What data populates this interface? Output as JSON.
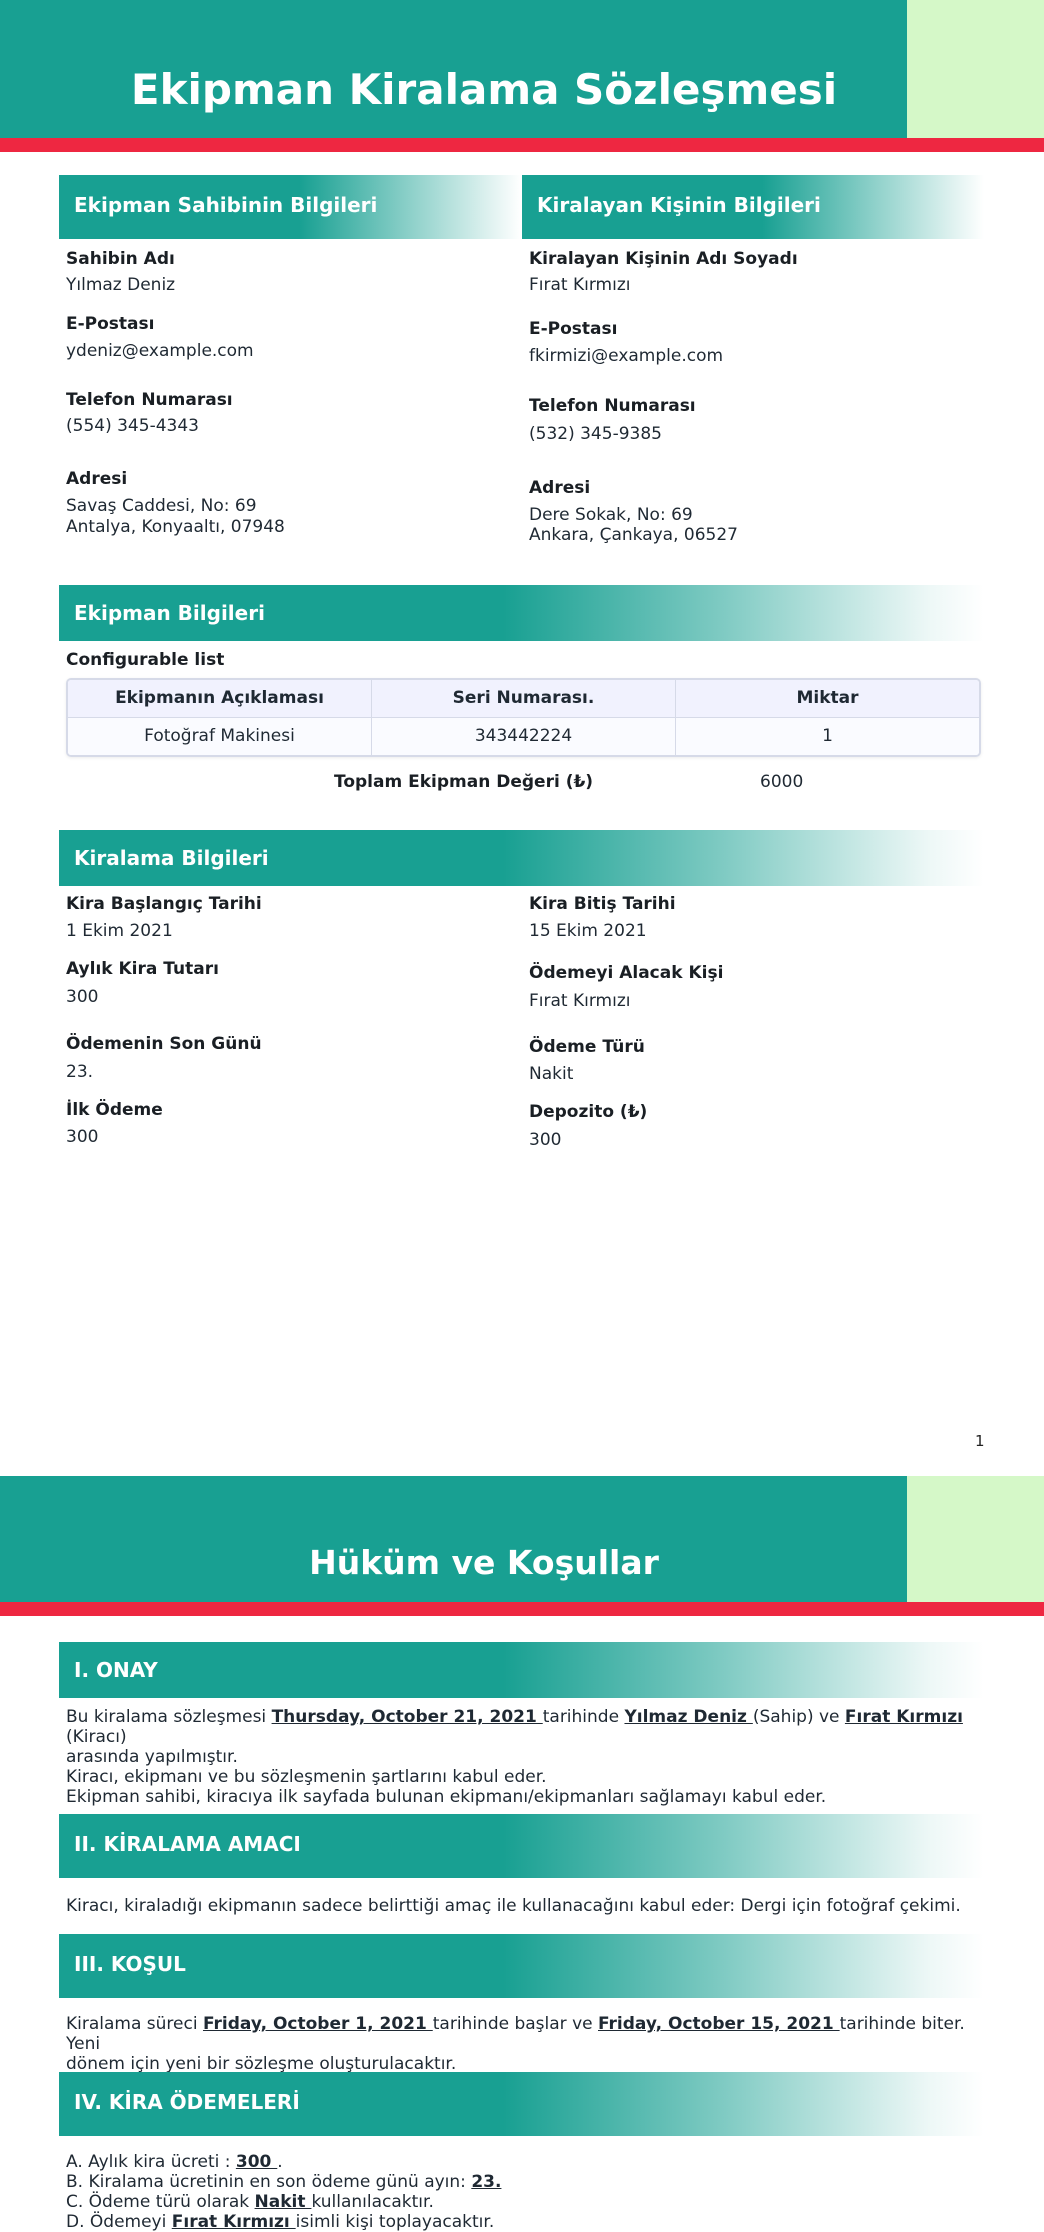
{
  "colors": {
    "teal": "#18a092",
    "mint": "#d5f8c8",
    "red": "#ee2741"
  },
  "page1": {
    "title": "Ekipman Kiralama Sözleşmesi",
    "owner": {
      "heading": "Ekipman Sahibinin Bilgileri",
      "name_label": "Sahibin Adı",
      "name": "Yılmaz Deniz",
      "email_label": "E-Postası",
      "email": "ydeniz@example.com",
      "phone_label": "Telefon Numarası",
      "phone": "(554) 345-4343",
      "address_label": "Adresi",
      "address_line1": "Savaş Caddesi, No: 69",
      "address_line2": "Antalya, Konyaaltı, 07948"
    },
    "renter": {
      "heading": "Kiralayan Kişinin Bilgileri",
      "name_label": "Kiralayan Kişinin Adı Soyadı",
      "name": "Fırat Kırmızı",
      "email_label": "E-Postası",
      "email": "fkirmizi@example.com",
      "phone_label": "Telefon Numarası",
      "phone": "(532) 345-9385",
      "address_label": "Adresi",
      "address_line1": "Dere Sokak, No: 69",
      "address_line2": "Ankara, Çankaya, 06527"
    },
    "equipment": {
      "heading": "Ekipman Bilgileri",
      "list_label": "Configurable list",
      "columns": [
        "Ekipmanın Açıklaması",
        "Seri Numarası.",
        "Miktar"
      ],
      "rows": [
        [
          "Fotoğraf Makinesi",
          "343442224",
          "1"
        ]
      ],
      "total_label": "Toplam Ekipman Değeri (₺)",
      "total_value": "6000"
    },
    "rental": {
      "heading": "Kiralama Bilgileri",
      "start_label": "Kira Başlangıç Tarihi",
      "start": "1 Ekim 2021",
      "end_label": "Kira Bitiş Tarihi",
      "end": "15 Ekim 2021",
      "monthly_label": "Aylık Kira Tutarı",
      "monthly": "300",
      "payee_label": "Ödemeyi Alacak Kişi",
      "payee": "Fırat Kırmızı",
      "due_label": "Ödemenin Son Günü",
      "due": "23.",
      "paytype_label": "Ödeme Türü",
      "paytype": "Nakit",
      "first_label": "İlk Ödeme",
      "first": "300",
      "deposit_label": "Depozito (₺)",
      "deposit": "300"
    },
    "page_number": "1"
  },
  "page2": {
    "title": "Hüküm ve Koşullar",
    "s1": {
      "heading": "I. ONAY",
      "p1_a": "Bu kiralama sözleşmesi ",
      "p1_date": " Thursday, October 21, 2021 ",
      "p1_b": " tarihinde ",
      "p1_owner": " Yılmaz Deniz ",
      "p1_c": "(Sahip) ve ",
      "p1_renter": " Fırat Kırmızı ",
      "p1_d": " (Kiracı)",
      "p1_e": "arasında yapılmıştır.",
      "p2": "Kiracı, ekipmanı ve bu sözleşmenin şartlarını kabul eder.",
      "p3": "Ekipman sahibi, kiracıya ilk sayfada bulunan ekipmanı/ekipmanları sağlamayı kabul eder."
    },
    "s2": {
      "heading": "II. KİRALAMA AMACI",
      "p1": "Kiracı, kiraladığı ekipmanın sadece belirttiği amaç ile kullanacağını kabul eder: Dergi için fotoğraf çekimi."
    },
    "s3": {
      "heading": "III. KOŞUL",
      "p1_a": "Kiralama süreci ",
      "p1_start": " Friday, October 1, 2021 ",
      "p1_b": " tarihinde başlar ve ",
      "p1_end": " Friday, October 15, 2021 ",
      "p1_c": " tarihinde biter. Yeni",
      "p1_d": "dönem için yeni bir sözleşme oluşturulacaktır."
    },
    "s4": {
      "heading": "IV. KİRA ÖDEMELERİ",
      "a_text": "A. Aylık kira ücreti : ",
      "a_val": " 300 ",
      "a_end": ".",
      "b_text": "B. Kiralama ücretinin en son ödeme günü ayın: ",
      "b_val": " 23. ",
      "c_text": "C. Ödeme türü olarak ",
      "c_val": " Nakit ",
      "c_end": " kullanılacaktır.",
      "d_text": "D. Ödemeyi ",
      "d_val": " Fırat Kırmızı ",
      "d_end": " isimli kişi toplayacaktır."
    }
  }
}
